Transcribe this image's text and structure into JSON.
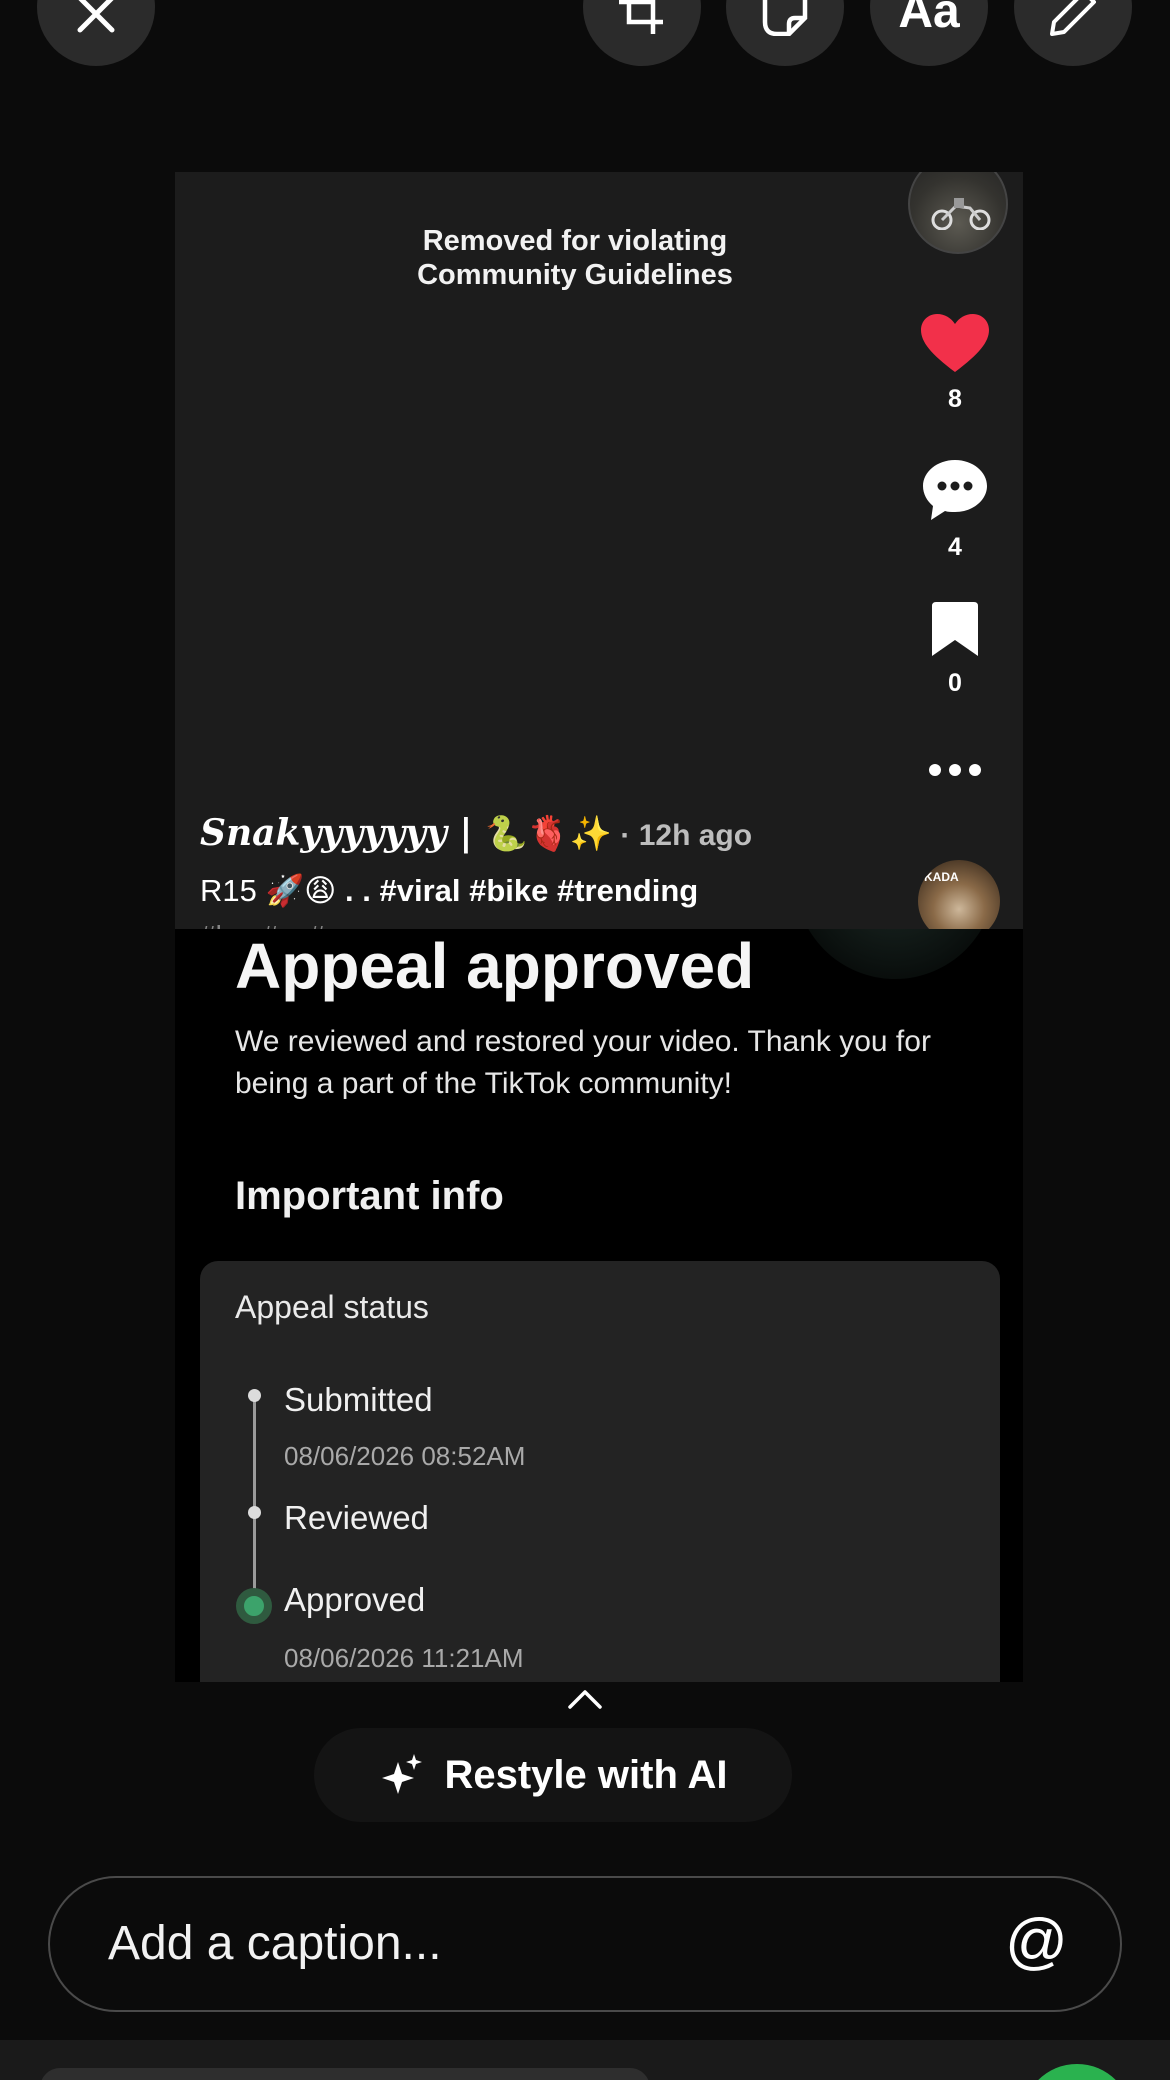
{
  "toolbar": {
    "close_icon": "close-icon",
    "crop_icon": "crop-rotate-icon",
    "sticker_icon": "sticker-icon",
    "text_label": "Aa",
    "draw_icon": "pencil-icon"
  },
  "video_post": {
    "notice": "Removed for violating Community Guidelines",
    "likes": "8",
    "comments": "4",
    "saves": "0",
    "username": "Snakyyyyyyy | ",
    "username_emoji": "🐍🫀✨",
    "time_ago": " · 12h ago",
    "caption_prefix": "R15 ",
    "caption_emoji": "🚀😩",
    "caption_tags": " . . #viral #bike #trending",
    "caption_overflow": "#b... #... #...",
    "music_disc_text": "KADA"
  },
  "appeal": {
    "title": "Appeal approved",
    "description": "We reviewed and restored your video. Thank you for being a part of the TikTok community!",
    "important_info": "Important info",
    "status_title": "Appeal status",
    "steps": [
      {
        "label": "Submitted",
        "time": "08/06/2026 08:52AM"
      },
      {
        "label": "Reviewed",
        "time": ""
      },
      {
        "label": "Approved",
        "time": "08/06/2026 11:21AM"
      }
    ]
  },
  "restyle_label": "Restyle with AI",
  "caption_input": {
    "placeholder": "Add a caption...",
    "mention_icon": "@"
  },
  "colors": {
    "like_red": "#f2304a",
    "approved_green": "#3ca36b",
    "send_green": "#2ab24f"
  }
}
